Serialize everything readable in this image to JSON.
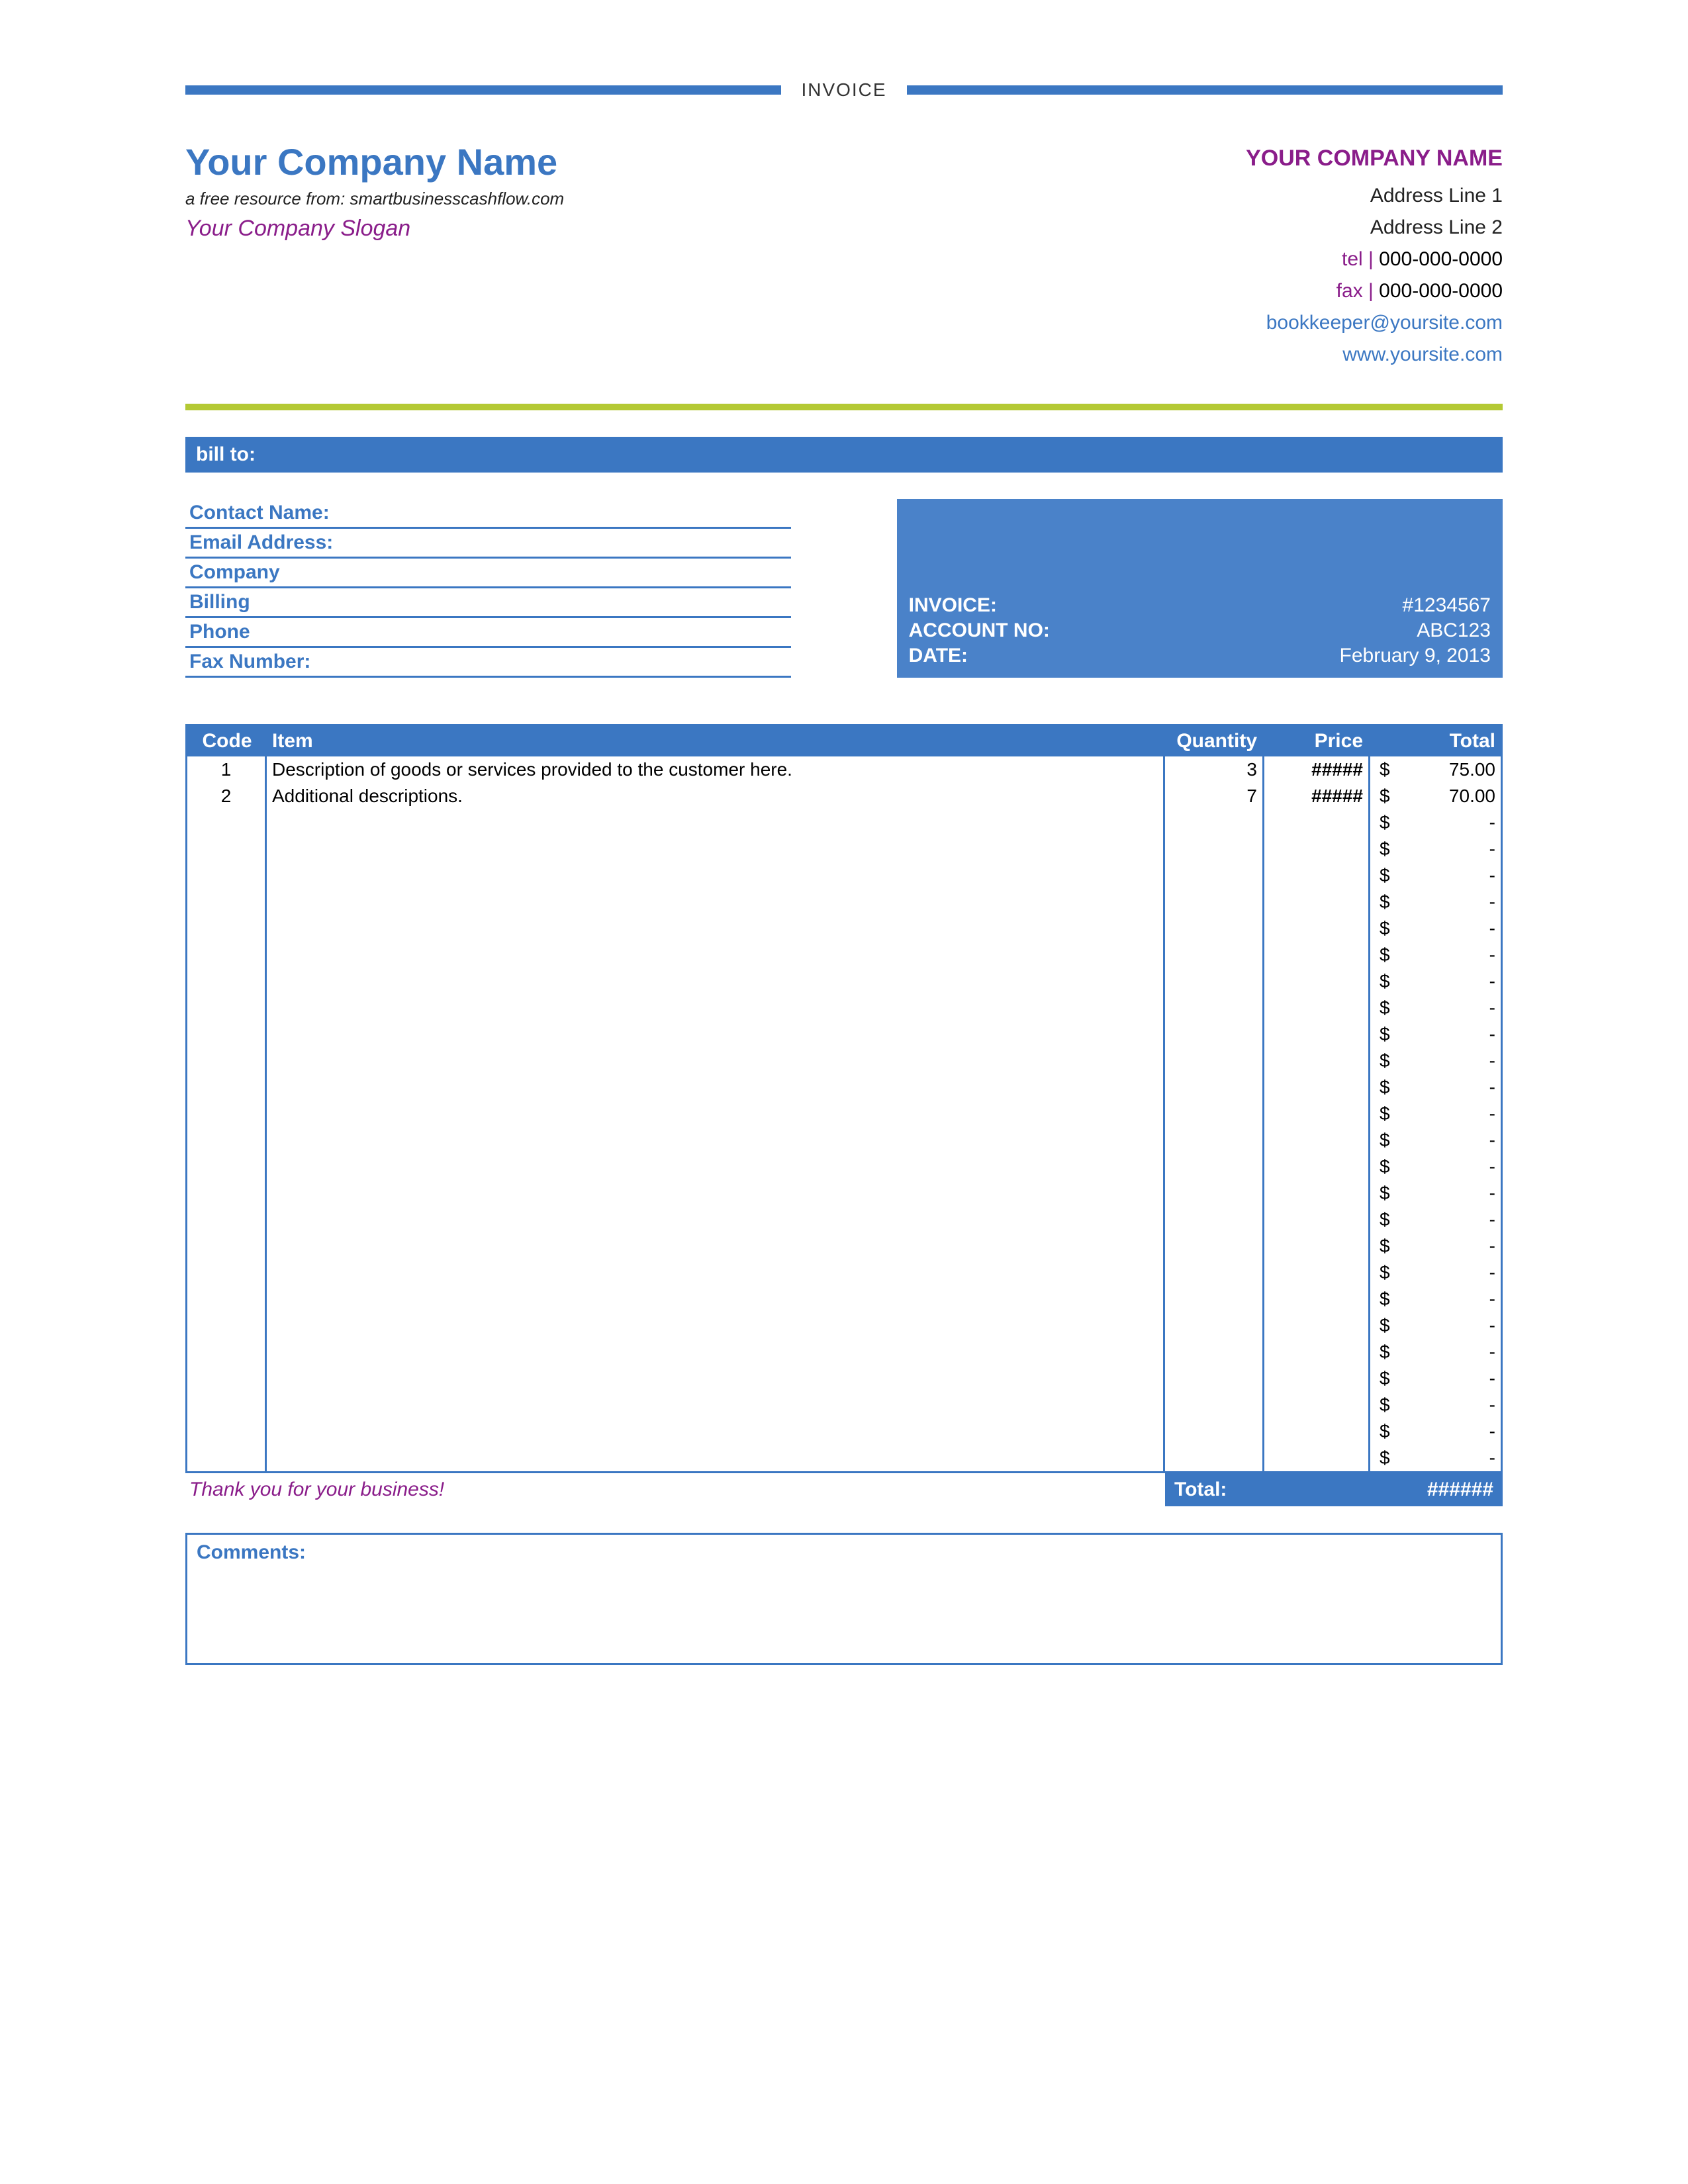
{
  "doc_title": "INVOICE",
  "company": {
    "name": "Your Company Name",
    "resource_line": "a free resource from: smartbusinesscashflow.com",
    "slogan": "Your Company Slogan",
    "right_name": "YOUR COMPANY NAME",
    "address1": "Address Line 1",
    "address2": "Address Line 2",
    "tel_label": "tel |",
    "tel": "000-000-0000",
    "fax_label": "fax |",
    "fax": "000-000-0000",
    "email": "bookkeeper@yoursite.com",
    "website": "www.yoursite.com"
  },
  "bill_to": {
    "title": "bill to:",
    "fields": {
      "contact": "Contact Name:",
      "email": "Email Address:",
      "company": "Company",
      "billing": "Billing",
      "phone": "Phone",
      "fax": "Fax Number:"
    }
  },
  "invoice_meta": {
    "invoice_label": "INVOICE:",
    "invoice_no": "#1234567",
    "account_label": "ACCOUNT NO:",
    "account_no": "ABC123",
    "date_label": "DATE:",
    "date": "February 9, 2013"
  },
  "columns": {
    "code": "Code",
    "item": "Item",
    "qty": "Quantity",
    "price": "Price",
    "total": "Total"
  },
  "currency": "$",
  "dash": "-",
  "overflow": "#####",
  "items": [
    {
      "code": "1",
      "desc": "Description of goods or services provided to the customer here.",
      "qty": "3",
      "price": "#####",
      "total": "75.00"
    },
    {
      "code": "2",
      "desc": "Additional descriptions.",
      "qty": "7",
      "price": "#####",
      "total": "70.00"
    },
    {
      "code": "",
      "desc": "",
      "qty": "",
      "price": "",
      "total": "-"
    },
    {
      "code": "",
      "desc": "",
      "qty": "",
      "price": "",
      "total": "-"
    },
    {
      "code": "",
      "desc": "",
      "qty": "",
      "price": "",
      "total": "-"
    },
    {
      "code": "",
      "desc": "",
      "qty": "",
      "price": "",
      "total": "-"
    },
    {
      "code": "",
      "desc": "",
      "qty": "",
      "price": "",
      "total": "-"
    },
    {
      "code": "",
      "desc": "",
      "qty": "",
      "price": "",
      "total": "-"
    },
    {
      "code": "",
      "desc": "",
      "qty": "",
      "price": "",
      "total": "-"
    },
    {
      "code": "",
      "desc": "",
      "qty": "",
      "price": "",
      "total": "-"
    },
    {
      "code": "",
      "desc": "",
      "qty": "",
      "price": "",
      "total": "-"
    },
    {
      "code": "",
      "desc": "",
      "qty": "",
      "price": "",
      "total": "-"
    },
    {
      "code": "",
      "desc": "",
      "qty": "",
      "price": "",
      "total": "-"
    },
    {
      "code": "",
      "desc": "",
      "qty": "",
      "price": "",
      "total": "-"
    },
    {
      "code": "",
      "desc": "",
      "qty": "",
      "price": "",
      "total": "-"
    },
    {
      "code": "",
      "desc": "",
      "qty": "",
      "price": "",
      "total": "-"
    },
    {
      "code": "",
      "desc": "",
      "qty": "",
      "price": "",
      "total": "-"
    },
    {
      "code": "",
      "desc": "",
      "qty": "",
      "price": "",
      "total": "-"
    },
    {
      "code": "",
      "desc": "",
      "qty": "",
      "price": "",
      "total": "-"
    },
    {
      "code": "",
      "desc": "",
      "qty": "",
      "price": "",
      "total": "-"
    },
    {
      "code": "",
      "desc": "",
      "qty": "",
      "price": "",
      "total": "-"
    },
    {
      "code": "",
      "desc": "",
      "qty": "",
      "price": "",
      "total": "-"
    },
    {
      "code": "",
      "desc": "",
      "qty": "",
      "price": "",
      "total": "-"
    },
    {
      "code": "",
      "desc": "",
      "qty": "",
      "price": "",
      "total": "-"
    },
    {
      "code": "",
      "desc": "",
      "qty": "",
      "price": "",
      "total": "-"
    },
    {
      "code": "",
      "desc": "",
      "qty": "",
      "price": "",
      "total": "-"
    },
    {
      "code": "",
      "desc": "",
      "qty": "",
      "price": "",
      "total": "-"
    }
  ],
  "thank_you": "Thank you for your business!",
  "total_label": "Total:",
  "total_value": "######",
  "comments_label": "Comments:"
}
